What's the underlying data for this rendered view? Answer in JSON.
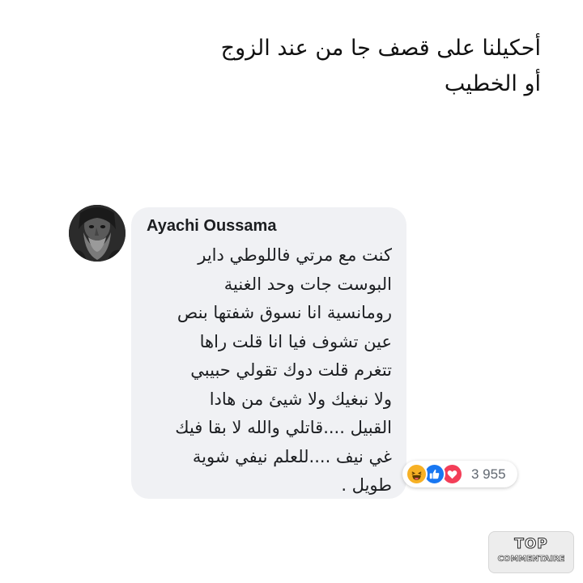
{
  "post": {
    "lines": [
      "أحكيلنا على قصف جا من عند الزوج",
      "أو الخطيب"
    ]
  },
  "comment": {
    "avatar_icon": "bearded-man-avatar",
    "author": "Ayachi Oussama",
    "lines": [
      "كنت مع مرتي فاللوطي داير",
      "البوست جات وحد الغنية",
      "رومانسية انا نسوق شفتها بنص",
      "عين تشوف فيا انا قلت راها",
      "تتغرم قلت دوك تقولي حبيبي",
      "ولا نبغيك ولا شيئ من هادا",
      "القبيل ....قاتلي والله لا بقا فيك",
      "غي نيف ....للعلم نيفي شوية",
      "طويل ."
    ],
    "reactions": {
      "icons": [
        "haha-icon",
        "like-icon",
        "love-icon"
      ],
      "count": "3 955"
    }
  },
  "watermark": {
    "line1": "TOP",
    "line2": "COMMENTAIRE"
  },
  "colors": {
    "bubble_bg": "#f0f1f4",
    "like_blue": "#1877f2",
    "love_red": "#f33e58",
    "haha_yellow": "#f7b125",
    "count_gray": "#606770"
  }
}
